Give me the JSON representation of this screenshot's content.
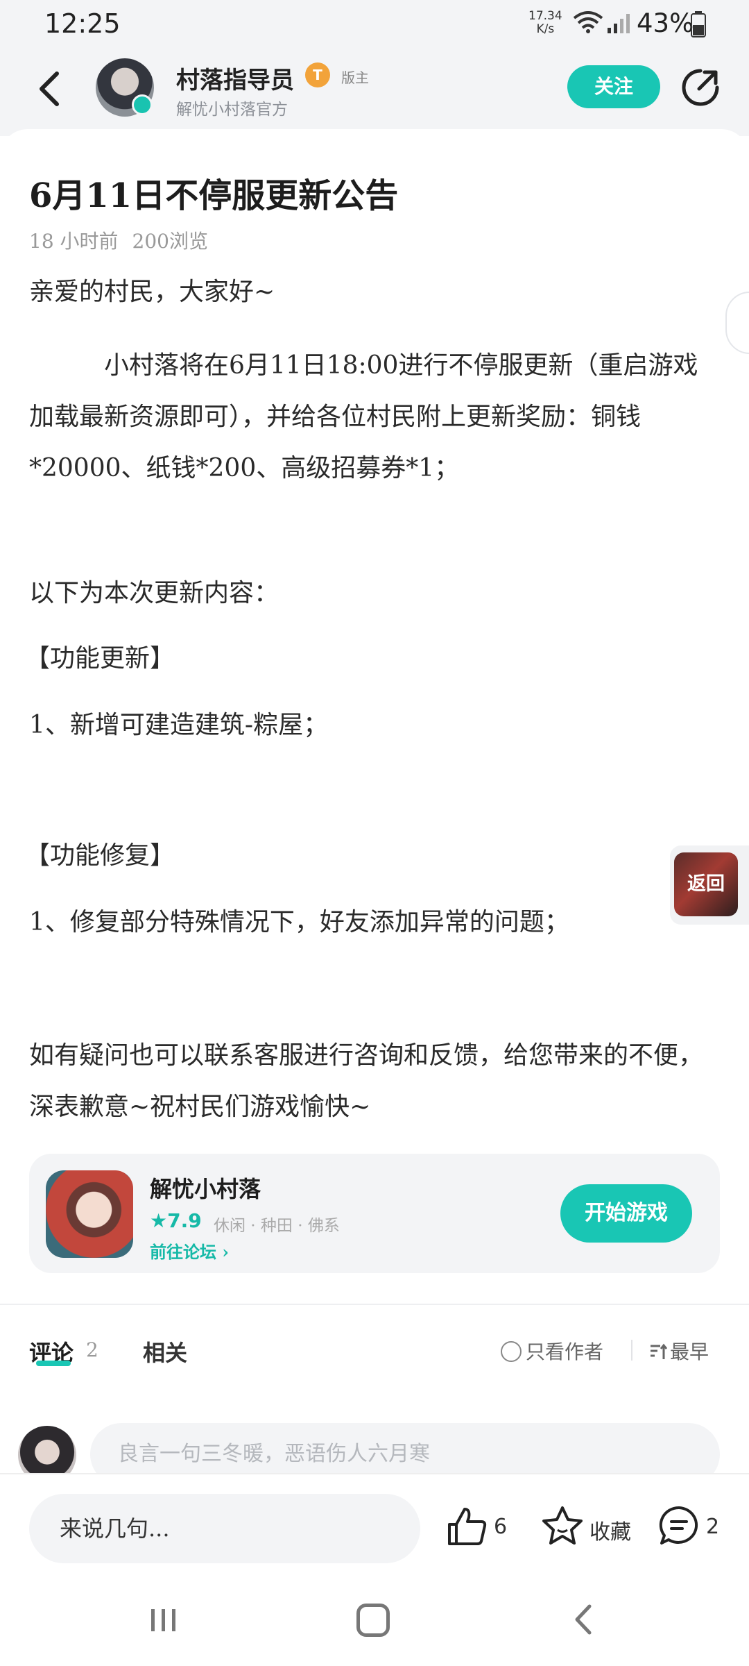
{
  "status_bar": {
    "time": "12:25",
    "speed_value": "17.34",
    "speed_unit": "K/s",
    "battery": "43%"
  },
  "header": {
    "author_name": "村落指导员",
    "admin_badge": "T",
    "admin_label": "版主",
    "author_subtitle": "解忧小村落官方",
    "follow_label": "关注"
  },
  "post": {
    "title": "6月11日不停服更新公告",
    "time_ago": "18 小时前",
    "views": "200浏览",
    "greeting": "亲爱的村民，大家好~",
    "paragraph1": "小村落将在6月11日18:00进行不停服更新（重启游戏加载最新资源即可），并给各位村民附上更新奖励：铜钱*20000、纸钱*200、高级招募券*1；",
    "intro": "以下为本次更新内容：",
    "section1_title": "【功能更新】",
    "section1_item": "1、新增可建造建筑-粽屋；",
    "section2_title": "【功能修复】",
    "section2_item": "1、修复部分特殊情况下，好友添加异常的问题；",
    "closing": "如有疑问也可以联系客服进行咨询和反馈，给您带来的不便，深表歉意~祝村民们游戏愉快~"
  },
  "floating": {
    "return_label": "返回"
  },
  "game_card": {
    "name": "解忧小村落",
    "rating": "7.9",
    "tags": "休闲 · 种田 · 佛系",
    "forum_link": "前往论坛",
    "start_label": "开始游戏"
  },
  "tabs": {
    "comments_label": "评论",
    "comments_count": "2",
    "related_label": "相关",
    "only_author": "只看作者",
    "sort_label": "最早"
  },
  "comment_input": {
    "placeholder": "良言一句三冬暖，恶语伤人六月寒"
  },
  "bottom_bar": {
    "say_placeholder": "来说几句...",
    "likes": "6",
    "favorite_label": "收藏",
    "comments": "2"
  },
  "colors": {
    "accent": "#19c6b4",
    "background": "#f3f4f6",
    "badge": "#f2a33a"
  }
}
